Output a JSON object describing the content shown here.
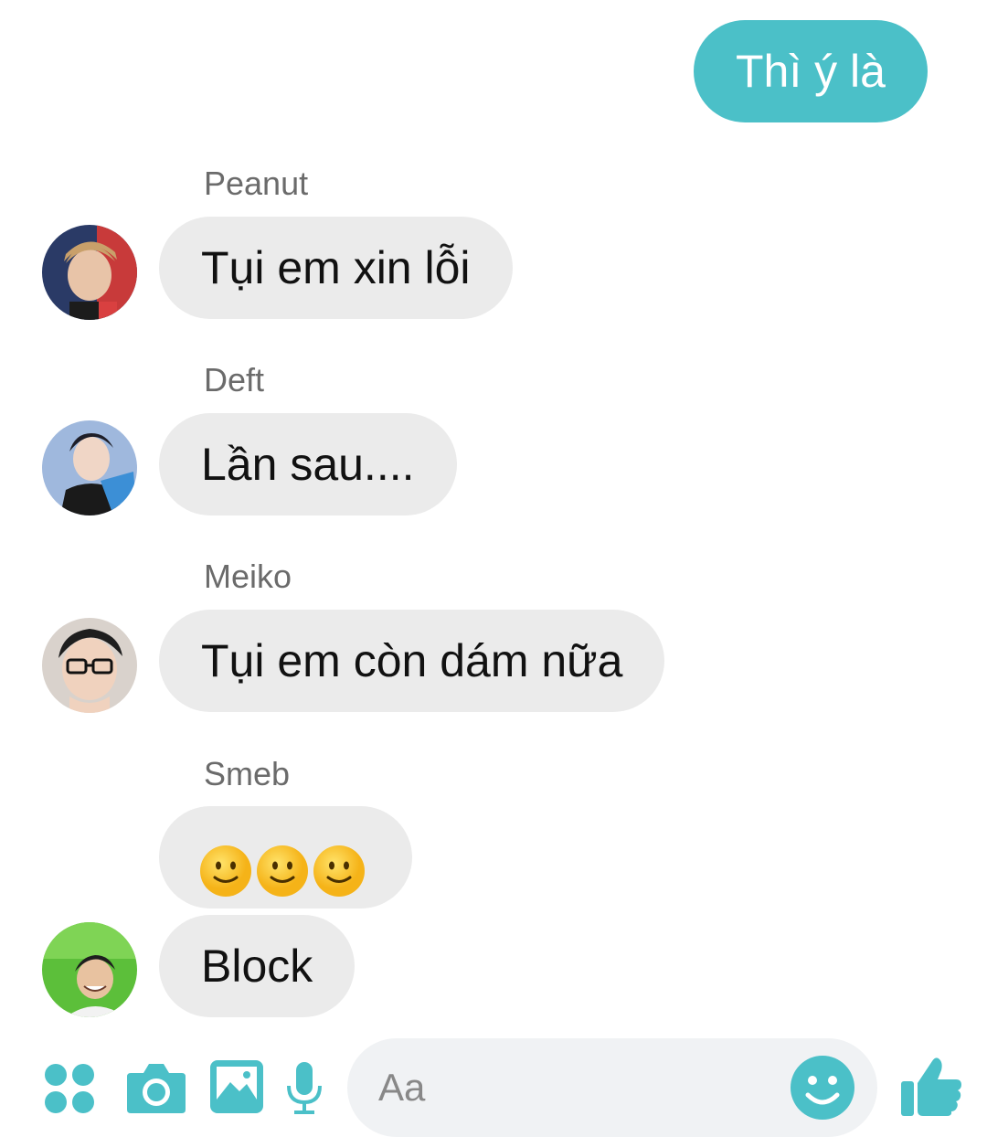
{
  "outgoing": [
    {
      "text": "Thì ý là"
    }
  ],
  "messages": [
    {
      "sender": "Peanut",
      "text": "Tụi em xin lỗi"
    },
    {
      "sender": "Deft",
      "text": "Lần sau...."
    },
    {
      "sender": "Meiko",
      "text": "Tụi em còn dám nữa"
    },
    {
      "sender": "Smeb",
      "emoji": [
        "slightly-smiling-face",
        "slightly-smiling-face",
        "slightly-smiling-face"
      ],
      "text": "Block"
    }
  ],
  "composer": {
    "placeholder": "Aa",
    "icons": [
      "apps-icon",
      "camera-icon",
      "image-icon",
      "microphone-icon",
      "emoji-icon",
      "thumbs-up-icon"
    ]
  },
  "colors": {
    "accent": "#4bc0c8",
    "incoming_bubble": "#ebebeb",
    "composer": "#f0f2f4"
  }
}
